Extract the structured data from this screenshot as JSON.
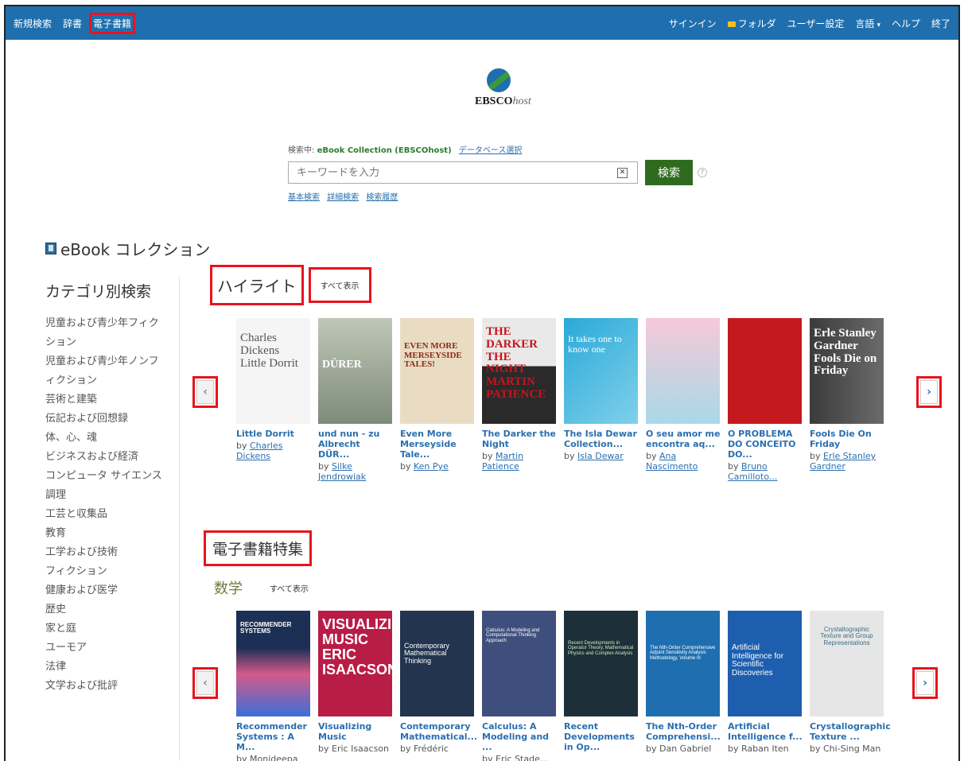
{
  "topnav": {
    "left": [
      "新規検索",
      "辞書",
      "電子書籍"
    ],
    "right": [
      "サインイン",
      "フォルダ",
      "ユーザー設定",
      "言語",
      "ヘルプ",
      "終了"
    ]
  },
  "logo": {
    "brand": "EBSCO",
    "suffix": "host"
  },
  "search": {
    "searching_label": "検索中:",
    "database": "eBook Collection (EBSCOhost)",
    "select_db": "データベース選択",
    "placeholder": "キーワードを入力",
    "button": "検索",
    "help": "?",
    "links": [
      "基本検索",
      "詳細検索",
      "検索履歴"
    ]
  },
  "collection_title": "eBook コレクション",
  "sidebar": {
    "title": "カテゴリ別検索",
    "items": [
      "児童および青少年フィクション",
      "児童および青少年ノンフィクション",
      "芸術と建築",
      "伝記および回想録",
      "体、心、魂",
      "ビジネスおよび経済",
      "コンピュータ サイエンス",
      "調理",
      "工芸と収集品",
      "教育",
      "工学および技術",
      "フィクション",
      "健康および医学",
      "歴史",
      "家と庭",
      "ユーモア",
      "法律",
      "文学および批評"
    ]
  },
  "highlights": {
    "title": "ハイライト",
    "show_all": "すべて表示",
    "books": [
      {
        "title": "Little Dorrit",
        "by": "by",
        "author": "Charles Dickens",
        "cover_text": "Charles Dickens Little Dorrit"
      },
      {
        "title": "und nun - zu Albrecht DÜR...",
        "by": "by",
        "author": "Silke Jendrowiak",
        "cover_text": "DÜRER"
      },
      {
        "title": "Even More Merseyside Tale...",
        "by": "by",
        "author": "Ken Pye",
        "cover_text": "EVEN MORE MERSEYSIDE TALES!"
      },
      {
        "title": "The Darker the Night",
        "by": "by",
        "author": "Martin Patience",
        "cover_text": "THE DARKER THE NIGHT MARTIN PATIENCE"
      },
      {
        "title": "The Isla Dewar Collection...",
        "by": "by",
        "author": "Isla Dewar",
        "cover_text": "It takes one to know one"
      },
      {
        "title": "O seu amor me encontra aq...",
        "by": "by",
        "author": "Ana Nascimento",
        "cover_text": ""
      },
      {
        "title": "O PROBLEMA DO CONCEITO DO...",
        "by": "by",
        "author": "Bruno Camilloto...",
        "cover_text": ""
      },
      {
        "title": "Fools Die On Friday",
        "by": "by",
        "author": "Erle Stanley Gardner",
        "cover_text": "Erle Stanley Gardner Fools Die on Friday"
      }
    ]
  },
  "featured": {
    "title": "電子書籍特集",
    "subtitle": "数学",
    "show_all": "すべて表示",
    "books": [
      {
        "title": "Recommender Systems : A M...",
        "by": "by",
        "author": "Monideepa",
        "author_link": false,
        "cover_text": "RECOMMENDER SYSTEMS"
      },
      {
        "title": "Visualizing Music",
        "by": "by",
        "author": "Eric Isaacson",
        "author_link": false,
        "cover_text": "VISUALIZING MUSIC ERIC ISAACSON"
      },
      {
        "title": "Contemporary Mathematical...",
        "by": "by",
        "author": "Frédéric",
        "author_link": false,
        "cover_text": "Contemporary Mathematical Thinking"
      },
      {
        "title": "Calculus: A Modeling and ...",
        "by": "by",
        "author": "Eric Stade...",
        "author_link": false,
        "cover_text": "Calculus: A Modeling and Computational Thinking Approach"
      },
      {
        "title": "Recent Developments in Op...",
        "by": "",
        "author": "",
        "author_link": false,
        "cover_text": "Recent Developments in Operator Theory, Mathematical Physics and Complex Analysis"
      },
      {
        "title": "The Nth-Order Comprehensi...",
        "by": "by",
        "author": "Dan Gabriel",
        "author_link": false,
        "cover_text": "The Nth-Order Comprehensive Adjoint Sensitivity Analysis Methodology, Volume III"
      },
      {
        "title": "Artificial Intelligence f...",
        "by": "by",
        "author": "Raban Iten",
        "author_link": false,
        "cover_text": "Artificial Intelligence for Scientific Discoveries"
      },
      {
        "title": "Crystallographic Texture ...",
        "by": "by",
        "author": "Chi-Sing Man",
        "author_link": false,
        "cover_text": "Crystallographic Texture and Group Representations"
      }
    ]
  },
  "colors": {
    "topbar": "#1f6fae",
    "search_button": "#2f6b1f",
    "link": "#2a6fb0",
    "highlight_box": "#e8141c"
  }
}
